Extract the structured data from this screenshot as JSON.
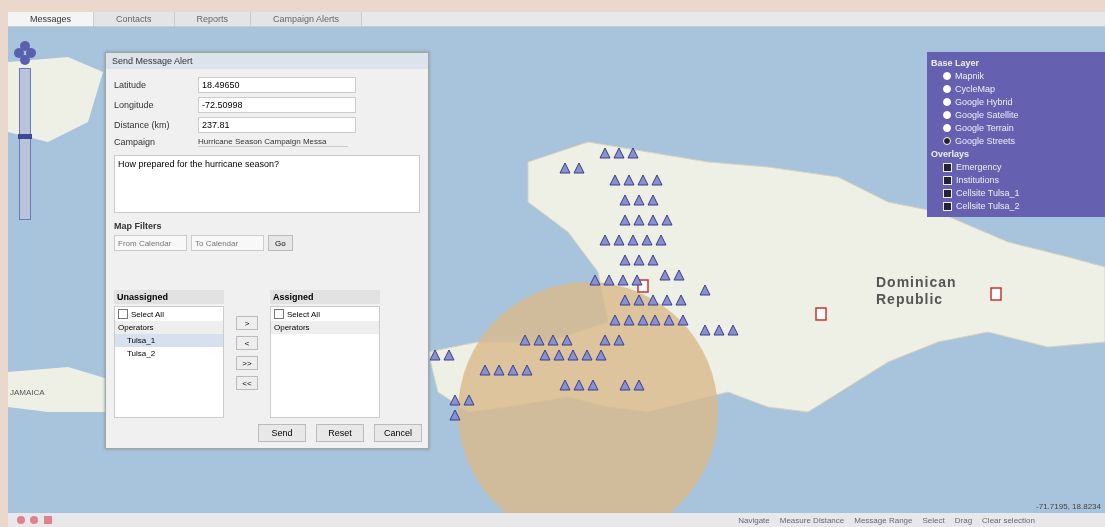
{
  "tabs": [
    {
      "label": "Messages",
      "selected": true
    },
    {
      "label": "Contacts",
      "selected": false
    },
    {
      "label": "Reports",
      "selected": false
    },
    {
      "label": "Campaign Alerts",
      "selected": false
    }
  ],
  "map": {
    "country_label": "Dominican Republic",
    "left_label": "JAMAICA",
    "zoom": {
      "level": 0.55
    }
  },
  "dialog": {
    "title": "Send Message Alert",
    "fields": [
      {
        "label": "Latitude",
        "value": "18.49650"
      },
      {
        "label": "Longitude",
        "value": "-72.50998"
      },
      {
        "label": "Distance (km)",
        "value": "237.81"
      }
    ],
    "campaign": {
      "label": "Campaign",
      "value": "Hurricane Season Campaign Messa"
    },
    "message": "How prepared for the hurricane season?",
    "section_title": "Map Filters",
    "filters": [
      {
        "placeholder": "From Calendar"
      },
      {
        "placeholder": "To Calendar"
      }
    ],
    "filter_button": "Go",
    "unassigned": {
      "title": "Unassigned",
      "select_all": "Select All",
      "select_all_checked": false,
      "header": "Operators",
      "items": [
        {
          "label": "Tulsa_1",
          "selected": true
        },
        {
          "label": "Tulsa_2",
          "selected": false
        }
      ]
    },
    "assigned": {
      "title": "Assigned",
      "select_all": "Select All",
      "select_all_checked": false,
      "header": "Operators"
    },
    "transfer_buttons": [
      ">",
      "<",
      ">>",
      "<<"
    ],
    "buttons": [
      "Send",
      "Reset",
      "Cancel"
    ]
  },
  "layers": {
    "base_title": "Base Layer",
    "base": [
      {
        "label": "Mapnik",
        "selected": false
      },
      {
        "label": "CycleMap",
        "selected": false
      },
      {
        "label": "Google Hybrid",
        "selected": false
      },
      {
        "label": "Google Satellite",
        "selected": false
      },
      {
        "label": "Google Terrain",
        "selected": false
      },
      {
        "label": "Google Streets",
        "selected": true
      }
    ],
    "overlay_title": "Overlays",
    "overlays": [
      {
        "label": "Emergency",
        "checked": true
      },
      {
        "label": "Institutions",
        "checked": true
      },
      {
        "label": "Cellsite Tulsa_1",
        "checked": true
      },
      {
        "label": "Cellsite Tulsa_2",
        "checked": true
      }
    ]
  },
  "status_bar": {
    "tools": [
      "Navigate",
      "Measure Distance",
      "Message Range",
      "Select",
      "Drag",
      "Clear selection"
    ],
    "coordinates": "-71.7195, 18.8234"
  }
}
